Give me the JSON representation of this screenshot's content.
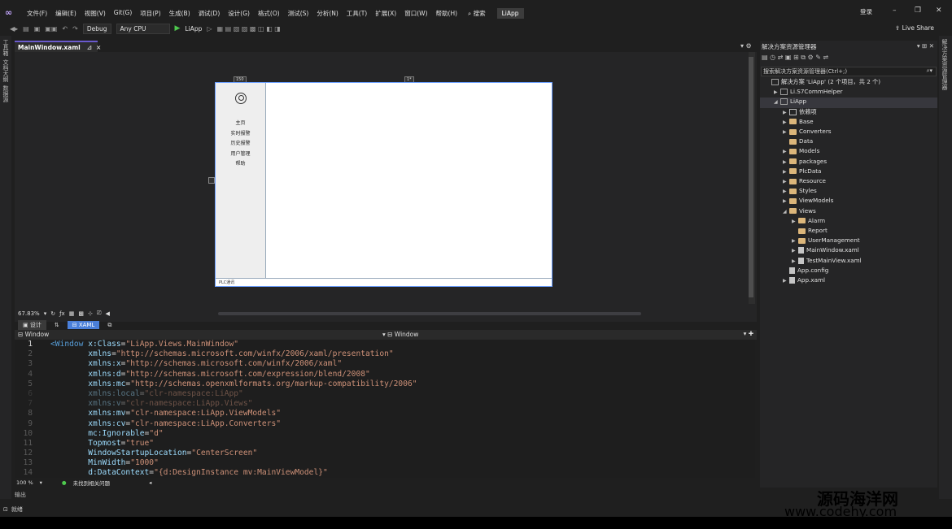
{
  "menubar": {
    "items": [
      "文件(F)",
      "编辑(E)",
      "视图(V)",
      "Git(G)",
      "项目(P)",
      "生成(B)",
      "调试(D)",
      "设计(G)",
      "格式(O)",
      "测试(S)",
      "分析(N)",
      "工具(T)",
      "扩展(X)",
      "窗口(W)",
      "帮助(H)"
    ],
    "search": "搜索",
    "app_name": "LiApp",
    "login": "登录"
  },
  "toolbar": {
    "config": "Debug",
    "platform": "Any CPU",
    "run_target": "LiApp",
    "live_share": "Live Share"
  },
  "left_strip": [
    "工具箱",
    "文档大纲",
    "数据源"
  ],
  "doc_tab": {
    "label": "MainWindow.xaml",
    "close": "×"
  },
  "designer": {
    "ruler_left": "150",
    "ruler_mid": "1*",
    "preview_nav": [
      "主页",
      "实时报警",
      "历史报警",
      "用户管理",
      "帮助"
    ],
    "preview_status": "PLC通讯"
  },
  "zoom": {
    "level": "67.83%"
  },
  "view_switch": {
    "design": "设计",
    "xaml": "XAML"
  },
  "crumbs": {
    "left": "Window",
    "right": "Window"
  },
  "code_lines": [
    {
      "n": "1",
      "parts": [
        [
          "tag",
          "<Window "
        ],
        [
          "attr",
          "x:Class"
        ],
        [
          "txt",
          "="
        ],
        [
          "val",
          "\"LiApp.Views.MainWindow\""
        ]
      ]
    },
    {
      "n": "2",
      "parts": [
        [
          "attr",
          "        xmlns"
        ],
        [
          "txt",
          "="
        ],
        [
          "val",
          "\"http://schemas.microsoft.com/winfx/2006/xaml/presentation\""
        ]
      ]
    },
    {
      "n": "3",
      "parts": [
        [
          "attr",
          "        xmlns:x"
        ],
        [
          "txt",
          "="
        ],
        [
          "val",
          "\"http://schemas.microsoft.com/winfx/2006/xaml\""
        ]
      ]
    },
    {
      "n": "4",
      "parts": [
        [
          "attr",
          "        xmlns:d"
        ],
        [
          "txt",
          "="
        ],
        [
          "val",
          "\"http://schemas.microsoft.com/expression/blend/2008\""
        ]
      ]
    },
    {
      "n": "5",
      "parts": [
        [
          "attr",
          "        xmlns:mc"
        ],
        [
          "txt",
          "="
        ],
        [
          "val",
          "\"http://schemas.openxmlformats.org/markup-compatibility/2006\""
        ]
      ]
    },
    {
      "n": "6",
      "dim": true,
      "parts": [
        [
          "attr",
          "        xmlns:local"
        ],
        [
          "txt",
          "="
        ],
        [
          "val",
          "\"clr-namespace:LiApp\""
        ]
      ]
    },
    {
      "n": "7",
      "dim": true,
      "parts": [
        [
          "attr",
          "        xmlns:v"
        ],
        [
          "txt",
          "="
        ],
        [
          "val",
          "\"clr-namespace:LiApp.Views\""
        ]
      ]
    },
    {
      "n": "8",
      "parts": [
        [
          "attr",
          "        xmlns:mv"
        ],
        [
          "txt",
          "="
        ],
        [
          "val",
          "\"clr-namespace:LiApp.ViewModels\""
        ]
      ]
    },
    {
      "n": "9",
      "parts": [
        [
          "attr",
          "        xmlns:cv"
        ],
        [
          "txt",
          "="
        ],
        [
          "val",
          "\"clr-namespace:LiApp.Converters\""
        ]
      ]
    },
    {
      "n": "10",
      "parts": [
        [
          "attr",
          "        mc:Ignorable"
        ],
        [
          "txt",
          "="
        ],
        [
          "val",
          "\"d\""
        ]
      ]
    },
    {
      "n": "11",
      "parts": [
        [
          "attr",
          "        Topmost"
        ],
        [
          "txt",
          "="
        ],
        [
          "val",
          "\"true\""
        ]
      ]
    },
    {
      "n": "12",
      "parts": [
        [
          "attr",
          "        WindowStartupLocation"
        ],
        [
          "txt",
          "="
        ],
        [
          "val",
          "\"CenterScreen\""
        ]
      ]
    },
    {
      "n": "13",
      "parts": [
        [
          "attr",
          "        MinWidth"
        ],
        [
          "txt",
          "="
        ],
        [
          "val",
          "\"1000\""
        ]
      ]
    },
    {
      "n": "14",
      "parts": [
        [
          "attr",
          "        d:DataContext"
        ],
        [
          "txt",
          "="
        ],
        [
          "val",
          "\"{d:DesignInstance mv:MainViewModel}\""
        ]
      ]
    }
  ],
  "editor_status": {
    "zoom": "100 %",
    "issues": "未找到相关问题"
  },
  "output_label": "输出",
  "status_bar": "就绪",
  "solution_explorer": {
    "title": "解决方案资源管理器",
    "search_placeholder": "搜索解决方案资源管理器(Ctrl+;)",
    "items": [
      {
        "label": "解决方案 'LiApp' (2 个项目，共 2 个)",
        "type": "solution",
        "indent": 0,
        "arrow": ""
      },
      {
        "label": "Li.S7CommHelper",
        "type": "proj",
        "indent": 1,
        "arrow": "▶"
      },
      {
        "label": "LiApp",
        "type": "proj",
        "indent": 1,
        "arrow": "◢",
        "selected": true
      },
      {
        "label": "依赖项",
        "type": "dep",
        "indent": 2,
        "arrow": "▶"
      },
      {
        "label": "Base",
        "type": "folder",
        "indent": 2,
        "arrow": "▶"
      },
      {
        "label": "Converters",
        "type": "folder",
        "indent": 2,
        "arrow": "▶"
      },
      {
        "label": "Data",
        "type": "folder",
        "indent": 2,
        "arrow": ""
      },
      {
        "label": "Models",
        "type": "folder",
        "indent": 2,
        "arrow": "▶"
      },
      {
        "label": "packages",
        "type": "folder",
        "indent": 2,
        "arrow": "▶"
      },
      {
        "label": "PlcData",
        "type": "folder",
        "indent": 2,
        "arrow": "▶"
      },
      {
        "label": "Resource",
        "type": "folder",
        "indent": 2,
        "arrow": "▶"
      },
      {
        "label": "Styles",
        "type": "folder",
        "indent": 2,
        "arrow": "▶"
      },
      {
        "label": "ViewModels",
        "type": "folder",
        "indent": 2,
        "arrow": "▶"
      },
      {
        "label": "Views",
        "type": "folder",
        "indent": 2,
        "arrow": "◢"
      },
      {
        "label": "Alarm",
        "type": "folder",
        "indent": 3,
        "arrow": "▶"
      },
      {
        "label": "Report",
        "type": "folder",
        "indent": 3,
        "arrow": ""
      },
      {
        "label": "UserManagement",
        "type": "folder",
        "indent": 3,
        "arrow": "▶"
      },
      {
        "label": "MainWindow.xaml",
        "type": "file",
        "indent": 3,
        "arrow": "▶"
      },
      {
        "label": "TestMainView.xaml",
        "type": "file",
        "indent": 3,
        "arrow": "▶"
      },
      {
        "label": "App.config",
        "type": "file",
        "indent": 2,
        "arrow": ""
      },
      {
        "label": "App.xaml",
        "type": "file",
        "indent": 2,
        "arrow": "▶"
      }
    ]
  },
  "watermark": {
    "line1": "源码海洋网",
    "line2": "www.codehy.com"
  }
}
